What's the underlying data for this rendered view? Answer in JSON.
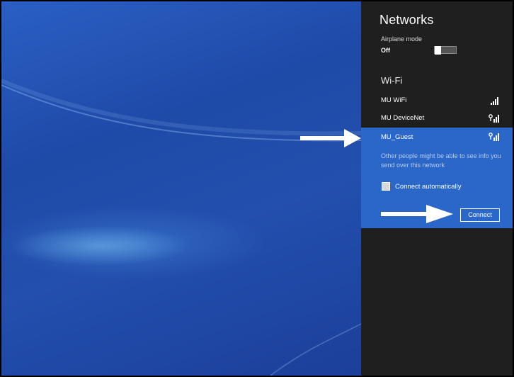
{
  "networks_panel": {
    "title": "Networks",
    "airplane_mode": {
      "label": "Airplane mode",
      "state": "Off"
    },
    "wifi_header": "Wi-Fi",
    "networks": [
      {
        "name": "MU WiFi",
        "secured": false
      },
      {
        "name": "MU DeviceNet",
        "secured": true
      },
      {
        "name": "MU_Guest",
        "secured": true,
        "selected": true
      }
    ],
    "selected_network": {
      "name": "MU_Guest",
      "warning": "Other people might be able to see info you send over this network",
      "connect_automatically_label": "Connect automatically",
      "connect_automatically_checked": false,
      "connect_button": "Connect"
    }
  },
  "colors": {
    "panel_bg": "#1f1f1f",
    "selected_bg": "#2a67c9",
    "desktop_blue": "#1e4aa8",
    "arrow": "#ffffff"
  },
  "icons": [
    "wifi-signal-icon",
    "secured-wifi-signal-icon",
    "checkbox-icon",
    "callout-arrow-icon"
  ]
}
